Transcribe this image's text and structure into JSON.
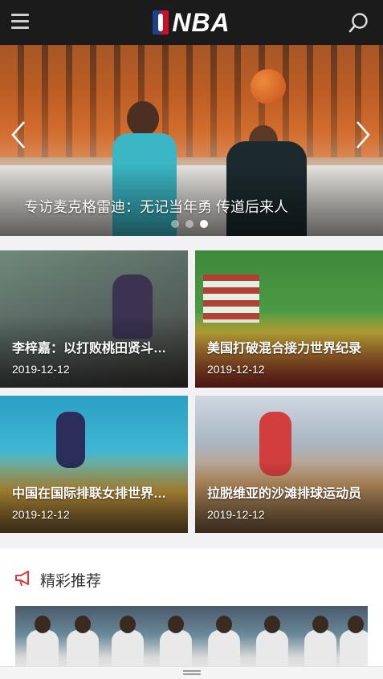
{
  "header": {
    "logo_text": "NBA",
    "menu_icon": "hamburger-menu-icon",
    "search_icon": "search-icon"
  },
  "hero": {
    "title": "专访麦克格雷迪：无记当年勇 传道后来人",
    "slide_count": 3,
    "active_slide": 3
  },
  "news": [
    {
      "title": "李梓嘉：以打败桃田贤斗为目标",
      "date": "2019-12-12"
    },
    {
      "title": "美国打破混合接力世界纪录",
      "date": "2019-12-12"
    },
    {
      "title": "中国在国际排联女排世界俱乐部",
      "date": "2019-12-12"
    },
    {
      "title": "拉脱维亚的沙滩排球运动员",
      "date": "2019-12-12"
    }
  ],
  "recommend": {
    "title": "精彩推荐",
    "icon": "megaphone-icon"
  },
  "colors": {
    "topbar": "#1b1b1b",
    "accent_red": "#e03a3a",
    "page_bg": "#f2f2f4"
  }
}
